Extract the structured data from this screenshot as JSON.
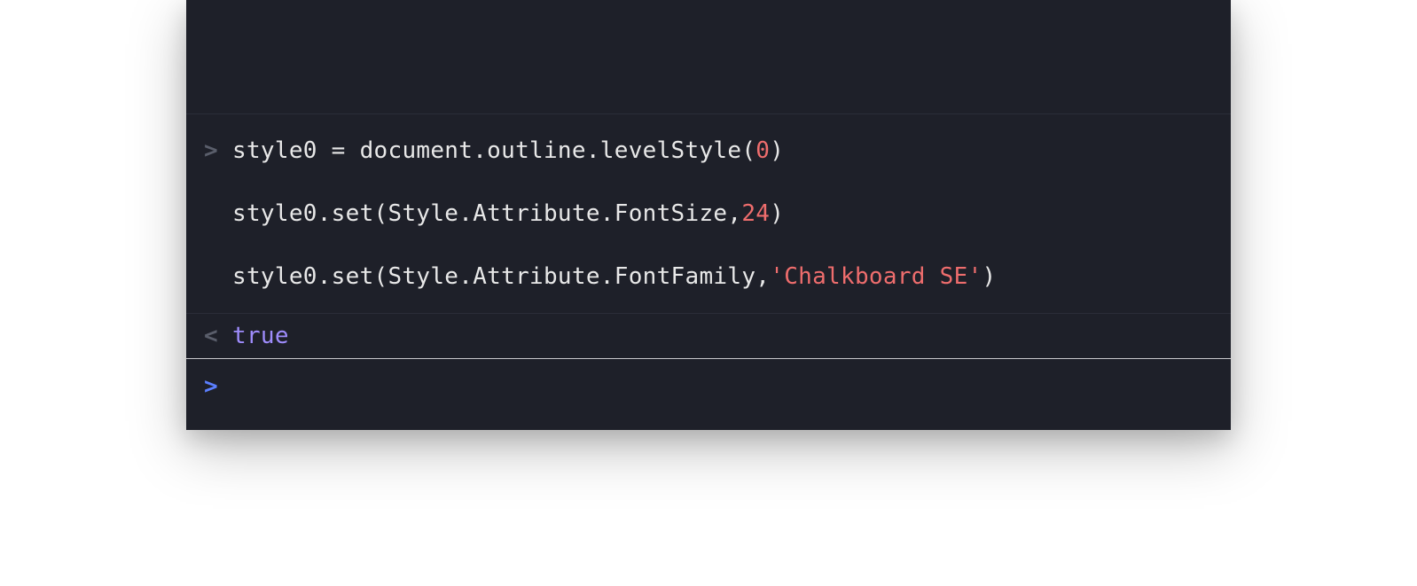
{
  "console": {
    "input_prompt_marker": ">",
    "output_marker": "<",
    "active_prompt_marker": ">",
    "history": [
      {
        "lines": [
          {
            "prefix": ">",
            "tokens": [
              {
                "text": "style0 = document.outline.levelStyle(",
                "class": "token-default"
              },
              {
                "text": "0",
                "class": "token-number"
              },
              {
                "text": ")",
                "class": "token-default"
              }
            ]
          },
          {
            "prefix": "",
            "tokens": [
              {
                "text": "style0.set(Style.Attribute.FontSize,",
                "class": "token-default"
              },
              {
                "text": "24",
                "class": "token-number"
              },
              {
                "text": ")",
                "class": "token-default"
              }
            ]
          },
          {
            "prefix": "",
            "tokens": [
              {
                "text": "style0.set(Style.Attribute.FontFamily,",
                "class": "token-default"
              },
              {
                "text": "'Chalkboard SE'",
                "class": "token-string"
              },
              {
                "text": ")",
                "class": "token-default"
              }
            ]
          }
        ],
        "output": "true"
      }
    ],
    "active_input_value": ""
  }
}
